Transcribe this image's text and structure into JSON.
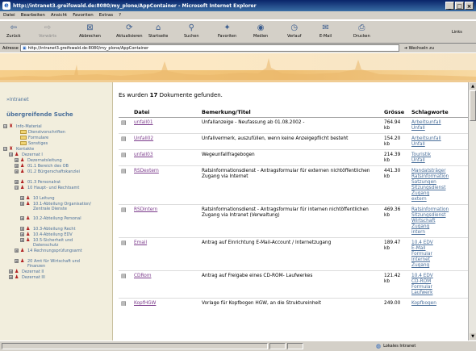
{
  "window": {
    "title": "http://intranet3.greifswald.de:8080/my_plone/AppContainer - Microsoft Internet Explorer",
    "controls": [
      "_",
      "□",
      "×"
    ]
  },
  "menu": [
    "Datei",
    "Bearbeiten",
    "Ansicht",
    "Favoriten",
    "Extras",
    "?"
  ],
  "toolbar": {
    "buttons": [
      {
        "label": "Zurück",
        "icon": "back-arrow-icon",
        "glyph": "⇦"
      },
      {
        "label": "Vorwärts",
        "icon": "forward-arrow-icon",
        "glyph": "⇨",
        "disabled": true
      },
      {
        "label": "Abbrechen",
        "icon": "stop-icon",
        "glyph": "⊠"
      },
      {
        "label": "Aktualisieren",
        "icon": "refresh-icon",
        "glyph": "⟳"
      },
      {
        "label": "Startseite",
        "icon": "home-icon",
        "glyph": "⌂"
      },
      {
        "label": "Suchen",
        "icon": "search-icon",
        "glyph": "⚲"
      },
      {
        "label": "Favoriten",
        "icon": "favorites-icon",
        "glyph": "✦"
      },
      {
        "label": "Medien",
        "icon": "media-icon",
        "glyph": "◉"
      },
      {
        "label": "Verlauf",
        "icon": "history-icon",
        "glyph": "◷"
      },
      {
        "label": "E-Mail",
        "icon": "mail-icon",
        "glyph": "✉"
      },
      {
        "label": "Drucken",
        "icon": "print-icon",
        "glyph": "⎙"
      }
    ],
    "links_label": "Links"
  },
  "address": {
    "label": "Adresse",
    "url": "http://intranet3.greifswald.de:8080/my_plone/AppContainer",
    "go_label": "Wechseln zu"
  },
  "sidebar": {
    "top_link": "»Intranet",
    "section_title": "übergreifende Suche",
    "tree": [
      {
        "label": "Info-Material",
        "indent": 0,
        "pm": "⊟",
        "icon": "group"
      },
      {
        "label": "Dienstvorschriften",
        "indent": 2,
        "icon": "folder"
      },
      {
        "label": "Formulare",
        "indent": 2,
        "icon": "folder"
      },
      {
        "label": "Sonstiges",
        "indent": 2,
        "icon": "folder"
      },
      {
        "label": "Kontakte",
        "indent": 0,
        "pm": "⊟",
        "icon": "group"
      },
      {
        "label": "Dezernat I",
        "indent": 1,
        "pm": "⊟",
        "icon": "person"
      },
      {
        "label": "Dezernatsleitung",
        "indent": 2,
        "pm": "⊞",
        "icon": "person"
      },
      {
        "label": "01.1 Bereich des OB",
        "indent": 2,
        "pm": "⊞",
        "icon": "person"
      },
      {
        "label": "01.2 Bürgerschaftskanzlei",
        "indent": 2,
        "pm": "⊞",
        "icon": "person",
        "size": "l2"
      },
      {
        "label": "01.3 Personalrat",
        "indent": 2,
        "pm": "⊞",
        "icon": "person"
      },
      {
        "label": "10 Haupt- und Rechtsamt",
        "indent": 2,
        "pm": "⊟",
        "icon": "person",
        "size": "l2"
      },
      {
        "label": "10 Leitung",
        "indent": 3,
        "pm": "⊞",
        "icon": "person"
      },
      {
        "label": "10.1-Abteilung Organisation/ Zentrale Dienste",
        "indent": 3,
        "pm": "⊞",
        "icon": "person",
        "size": "l3"
      },
      {
        "label": "10.2-Abteilung Personal",
        "indent": 3,
        "pm": "⊞",
        "icon": "person",
        "size": "l2"
      },
      {
        "label": "10.3-Abteilung Recht",
        "indent": 3,
        "pm": "⊞",
        "icon": "person"
      },
      {
        "label": "10.4-Abteilung EDV",
        "indent": 3,
        "pm": "⊞",
        "icon": "person"
      },
      {
        "label": "10.5-Sicherheit und Datenschutz",
        "indent": 3,
        "pm": "⊞",
        "icon": "person",
        "size": "l2"
      },
      {
        "label": "14 Rechnungsprüfungsamt",
        "indent": 2,
        "pm": "⊞",
        "icon": "person",
        "size": "l2"
      },
      {
        "label": "20 Amt für Wirtschaft und Finanzen",
        "indent": 2,
        "pm": "⊞",
        "icon": "person",
        "size": "l2"
      },
      {
        "label": "Dezernat II",
        "indent": 1,
        "pm": "⊞",
        "icon": "person"
      },
      {
        "label": "Dezernat III",
        "indent": 1,
        "pm": "⊞",
        "icon": "person"
      }
    ]
  },
  "results": {
    "prefix": "Es wurden",
    "count": "17",
    "suffix": "Dokumente gefunden.",
    "columns": [
      "Datei",
      "Bemerkung/Titel",
      "Grösse",
      "Schlagworte"
    ],
    "rows": [
      {
        "file": "unfall01",
        "title": "Unfallanzeige - Neufassung ab 01.08.2002 -",
        "size": "764.94 kb",
        "tags": [
          "Arbeitsunfall",
          "Unfall"
        ]
      },
      {
        "file": "Unfall02",
        "title": "Unfallvermerk, auszufüllen, wenn keine Anzeigepflicht besteht",
        "size": "154.20 kb",
        "tags": [
          "Arbeitsunfall",
          "Unfall"
        ]
      },
      {
        "file": "unfall03",
        "title": "Wegeunfallfragebogen",
        "size": "214.39 kb",
        "tags": [
          "Touristik",
          "Unfall"
        ]
      },
      {
        "file": "RSDextern",
        "title": "Ratsinformationsdienst - Antragsformular für externen nichtöffentlichen Zugang via Internet",
        "size": "441.30 kb",
        "tags": [
          "Mandatsträger",
          "Ratsinformation",
          "Satzungen",
          "Sitzungsdienst",
          "Zugang",
          "extern"
        ]
      },
      {
        "file": "RSDintern",
        "title": "Ratsinformationsdienst - Antragsformular für internen nichtöffentlichen Zugang via Intranet (Verwaltung)",
        "size": "469.36 kb",
        "tags": [
          "Ratsinformation",
          "Sitzungsdienst",
          "Wirtschaft",
          "Zugang",
          "intern"
        ]
      },
      {
        "file": "Email",
        "title": "Antrag auf Einrichtung E-Mail-Account / Internetzugang",
        "size": "189.47 kb",
        "tags": [
          "10.4 EDV",
          "E-Mail",
          "Formular",
          "Internet",
          "Zugang"
        ]
      },
      {
        "file": "CDRom",
        "title": "Antrag auf Freigabe eines CD-ROM- Laufwerkes",
        "size": "121.42 kb",
        "tags": [
          "10.4 EDV",
          "CD-ROM",
          "Formular",
          "Laufwerk"
        ]
      },
      {
        "file": "KopfHGW",
        "title": "Vorlage für Kopfbogen HGW, an die Struktureinheit",
        "size": "249.00",
        "tags": [
          "Kopfbogen"
        ]
      }
    ]
  },
  "status": {
    "zone": "Lokales Intranet"
  }
}
